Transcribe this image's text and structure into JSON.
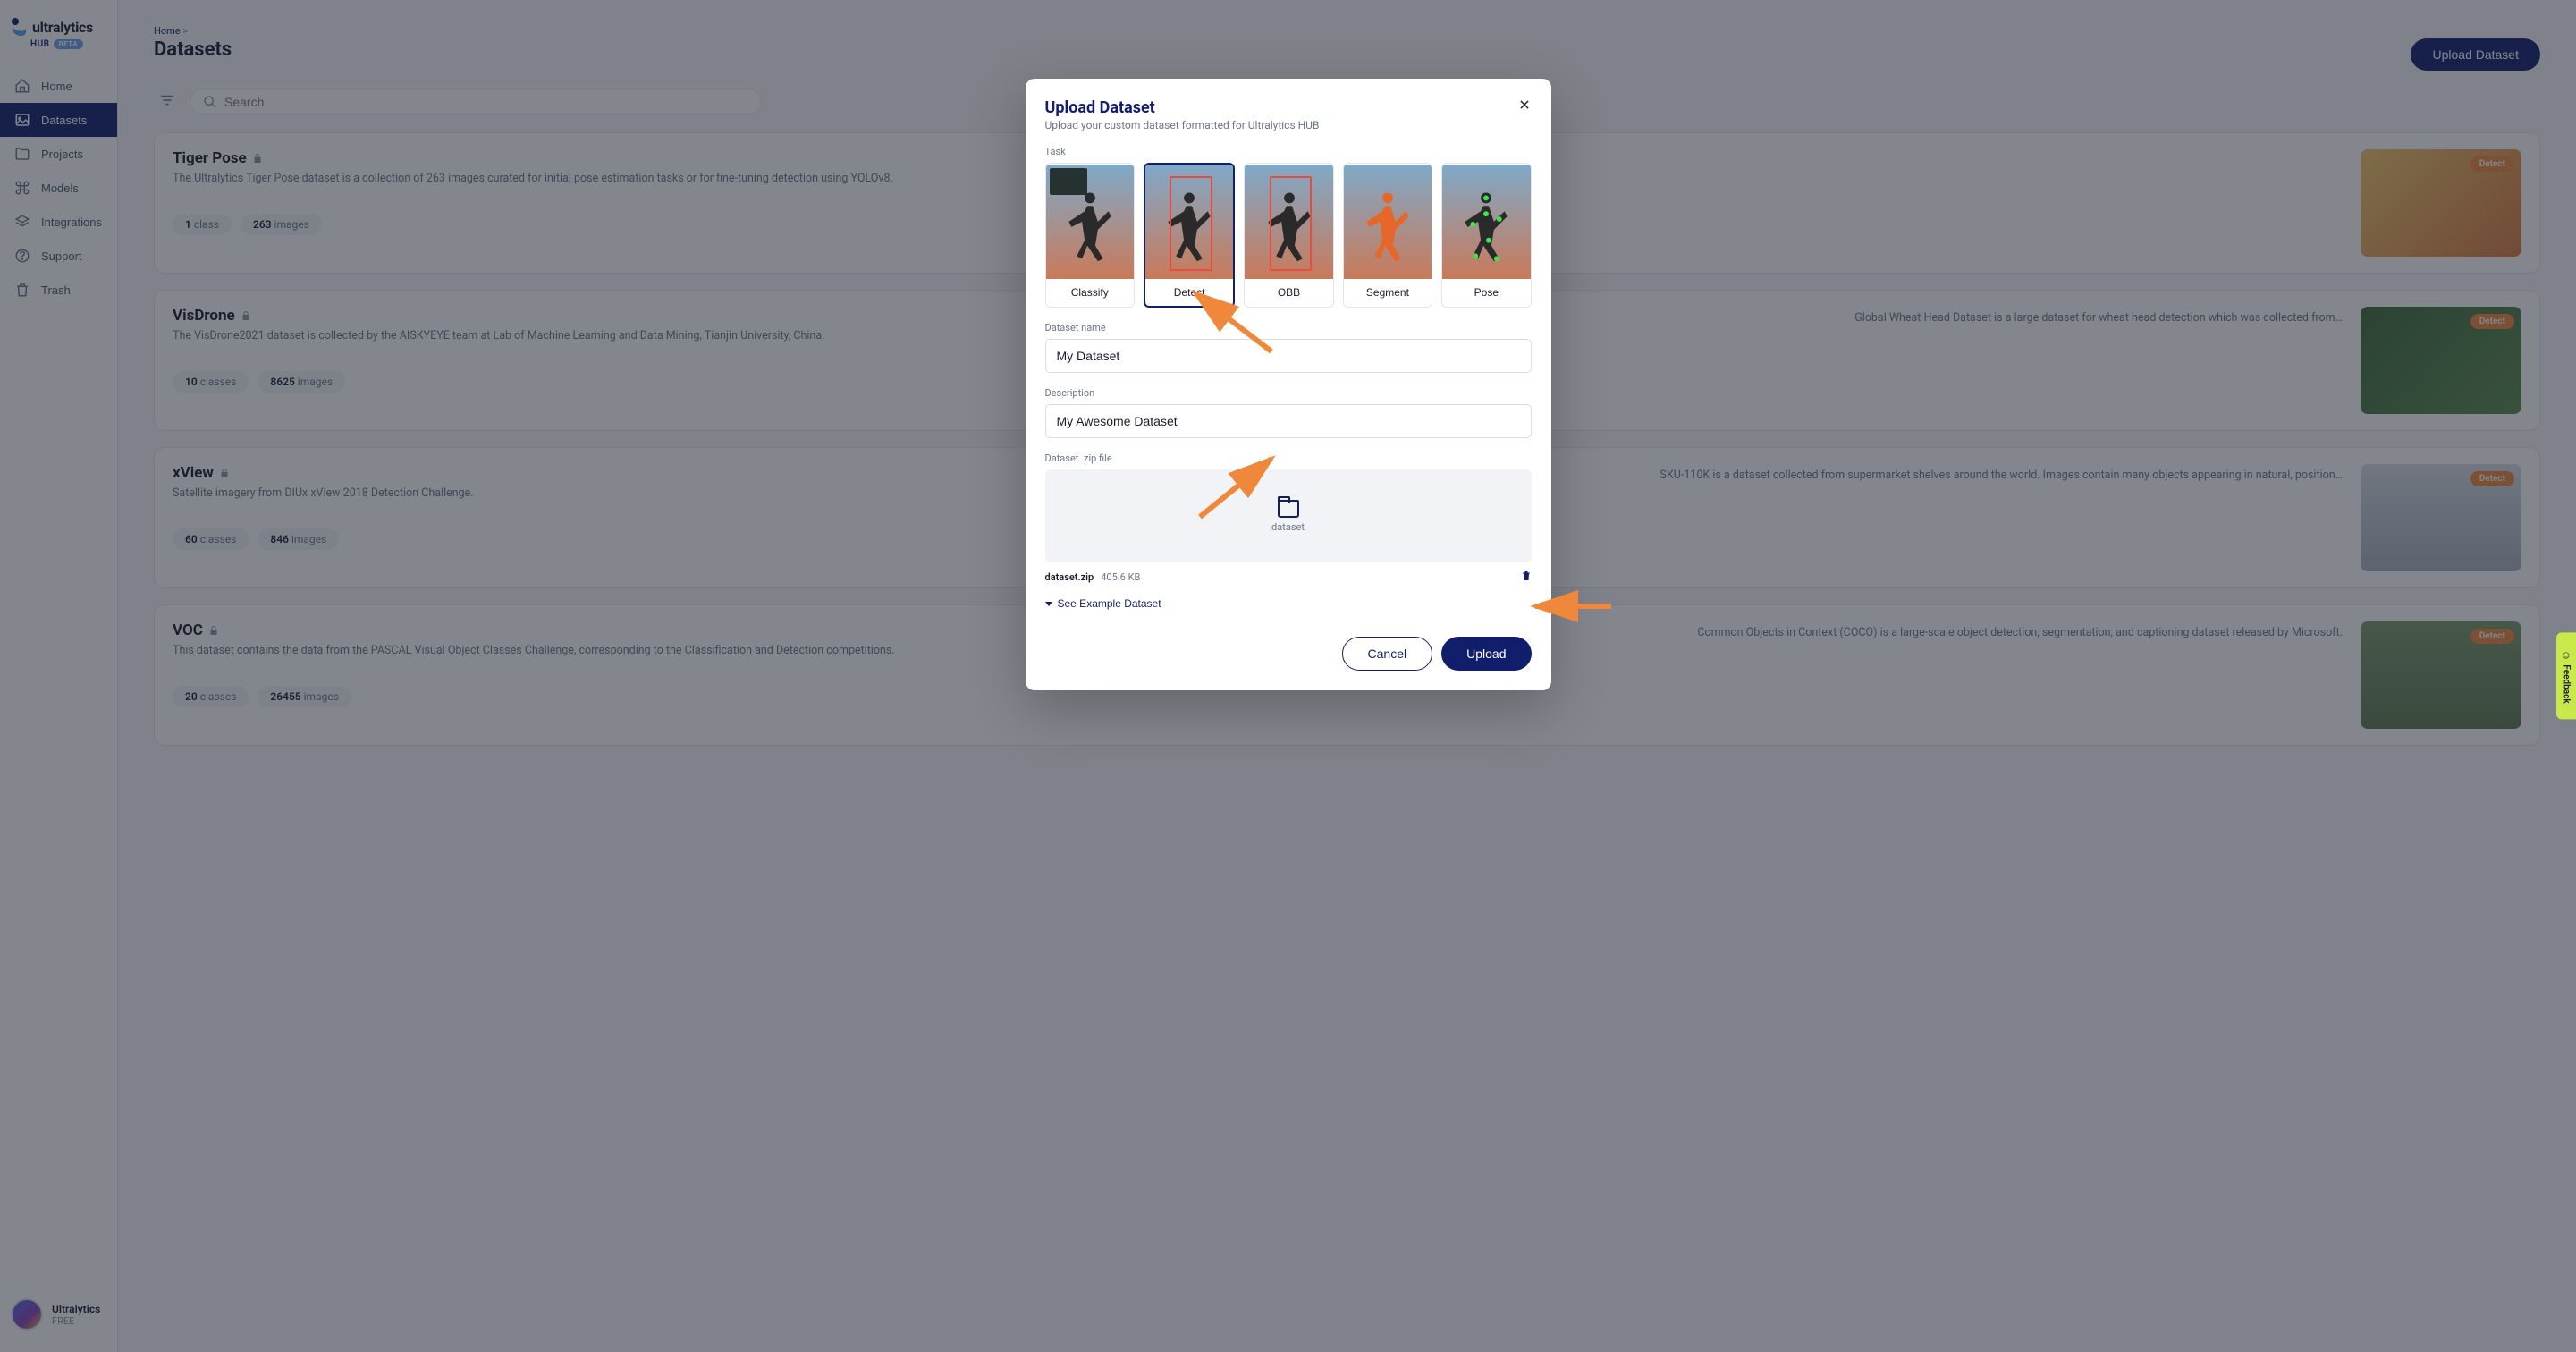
{
  "brand": {
    "name": "ultralytics",
    "sub": "HUB",
    "badge": "BETA"
  },
  "nav": {
    "home": "Home",
    "datasets": "Datasets",
    "projects": "Projects",
    "models": "Models",
    "integrations": "Integrations",
    "support": "Support",
    "trash": "Trash"
  },
  "user": {
    "name": "Ultralytics",
    "plan": "FREE"
  },
  "breadcrumb": {
    "home": "Home",
    "sep": ">"
  },
  "page": {
    "title": "Datasets"
  },
  "upload_main": "Upload Dataset",
  "search": {
    "placeholder": "Search"
  },
  "datasets": [
    {
      "title": "Tiger Pose",
      "desc": "The Ultralytics Tiger Pose dataset is a collection of 263 images curated for initial pose estimation tasks or for fine-tuning detection using YOLOv8.",
      "classes_n": "1",
      "classes_l": "class",
      "images_n": "263",
      "images_l": "images",
      "badge": "Detect"
    },
    {
      "title": "VisDrone",
      "desc": "The VisDrone2021 dataset is collected by the AISKYEYE team at Lab of Machine Learning and Data Mining, Tianjin University, China.",
      "desc2": "Global Wheat Head Dataset is a large dataset for wheat head detection which was collected from…",
      "classes_n": "10",
      "classes_l": "classes",
      "images_n": "8625",
      "images_l": "images",
      "badge": "Detect"
    },
    {
      "title": "xView",
      "desc": "Satellite imagery from DIUx xView 2018 Detection Challenge.",
      "desc2": "SKU-110K is a dataset collected from supermarket shelves around the world. Images contain many objects appearing in natural, position…",
      "classes_n": "60",
      "classes_l": "classes",
      "images_n": "846",
      "images_l": "images",
      "badge": "Detect"
    },
    {
      "title": "VOC",
      "desc": "This dataset contains the data from the PASCAL Visual Object Classes Challenge, corresponding to the Classification and Detection competitions.",
      "desc2": "Common Objects in Context (COCO) is a large-scale object detection, segmentation, and captioning dataset released by Microsoft.",
      "classes_n": "20",
      "classes_l": "classes",
      "images_n": "26455",
      "images_l": "images",
      "badge": "Detect"
    }
  ],
  "modal": {
    "title": "Upload Dataset",
    "subtitle": "Upload your custom dataset formatted for Ultralytics HUB",
    "task_label": "Task",
    "tasks": [
      "Classify",
      "Detect",
      "OBB",
      "Segment",
      "Pose"
    ],
    "selected_task": 1,
    "name_label": "Dataset name",
    "name_value": "My Dataset",
    "desc_label": "Description",
    "desc_value": "My Awesome Dataset",
    "zip_label": "Dataset .zip file",
    "drop_label": "dataset",
    "file_name": "dataset.zip",
    "file_size": "405.6 KB",
    "example_link": "See Example Dataset",
    "cancel": "Cancel",
    "upload": "Upload"
  },
  "feedback": "Feedback"
}
